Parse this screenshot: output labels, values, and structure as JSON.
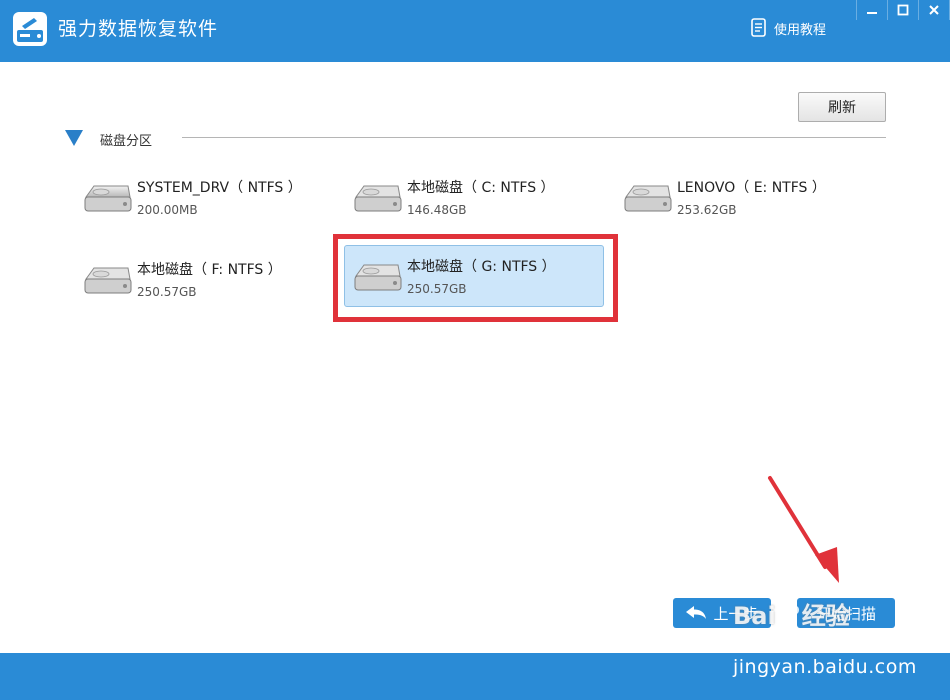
{
  "app": {
    "title": "强力数据恢复软件"
  },
  "header": {
    "tutorial_label": "使用教程"
  },
  "toolbar": {
    "refresh_label": "刷新"
  },
  "section": {
    "title": "磁盘分区"
  },
  "disks": [
    {
      "name": "SYSTEM_DRV（ NTFS ）",
      "size": "200.00MB",
      "selected": false
    },
    {
      "name": "本地磁盘（ C: NTFS ）",
      "size": "146.48GB",
      "selected": false
    },
    {
      "name": "LENOVO（ E: NTFS ）",
      "size": "253.62GB",
      "selected": false
    },
    {
      "name": "本地磁盘（ F: NTFS ）",
      "size": "250.57GB",
      "selected": false
    },
    {
      "name": "本地磁盘（ G: NTFS ）",
      "size": "250.57GB",
      "selected": true
    }
  ],
  "footer_buttons": {
    "back_label": "上一步",
    "scan_label": "开始扫描"
  },
  "watermark": {
    "brand_pre": "Bai",
    "brand_post": "经验",
    "url": "jingyan.baidu.com"
  },
  "colors": {
    "accent": "#2a8bd6",
    "selection": "#cde6fa",
    "highlight": "#e0323a"
  },
  "icons": {
    "app_logo": "hard-drive-logo-icon",
    "tutorial": "document-icon",
    "hdd": "hard-drive-icon",
    "collapse": "triangle-down-icon",
    "back": "undo-arrow-icon"
  }
}
